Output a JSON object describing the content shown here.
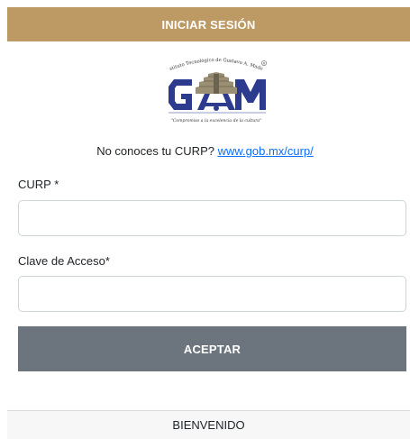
{
  "header": {
    "title": "INICIAR SESIÓN"
  },
  "logo": {
    "institution_text": "Instituto Tecnológico de Gustavo A. Madero",
    "motto": "\"Compromiso a la excelencia de la cultura\"",
    "letters": "GAM",
    "colors": {
      "letters": "#2c3b8e",
      "pyramid": "#9a8f73",
      "pyramid_dark": "#6b6350",
      "sky": "#ffffff",
      "text": "#333333"
    }
  },
  "curp_help": {
    "question": "No conoces tu CURP?",
    "link_text": "www.gob.mx/curp/"
  },
  "form": {
    "curp_label": "CURP *",
    "curp_value": "",
    "curp_placeholder": "",
    "password_label": "Clave de Acceso*",
    "password_value": "",
    "password_placeholder": "",
    "submit_label": "ACEPTAR"
  },
  "footer": {
    "text": "BIENVENIDO"
  },
  "colors": {
    "header_bg": "#bd9a64",
    "button_bg": "#6c757d",
    "link": "#0d6efd"
  }
}
